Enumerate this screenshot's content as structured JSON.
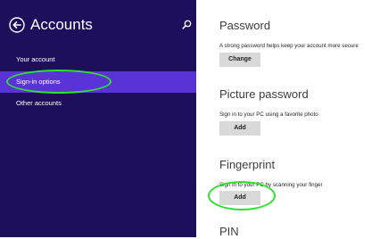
{
  "sidebar": {
    "title": "Accounts",
    "items": [
      {
        "label": "Your account"
      },
      {
        "label": "Sign-in options"
      },
      {
        "label": "Other accounts"
      }
    ]
  },
  "sections": [
    {
      "title": "Password",
      "description": "A strong password helps keep your account more secure",
      "button": "Change"
    },
    {
      "title": "Picture password",
      "description": "Sign in to your PC using a favorite photo",
      "button": "Add"
    },
    {
      "title": "Fingerprint",
      "description": "Sign in to your PC by scanning your finger",
      "button": "Add"
    },
    {
      "title": "PIN"
    }
  ],
  "colors": {
    "sidebar_bg": "#1d0f5c",
    "selected_bg": "#5a33d6",
    "highlight_ring": "#2fe02f",
    "button_bg": "#d9d9d9"
  }
}
